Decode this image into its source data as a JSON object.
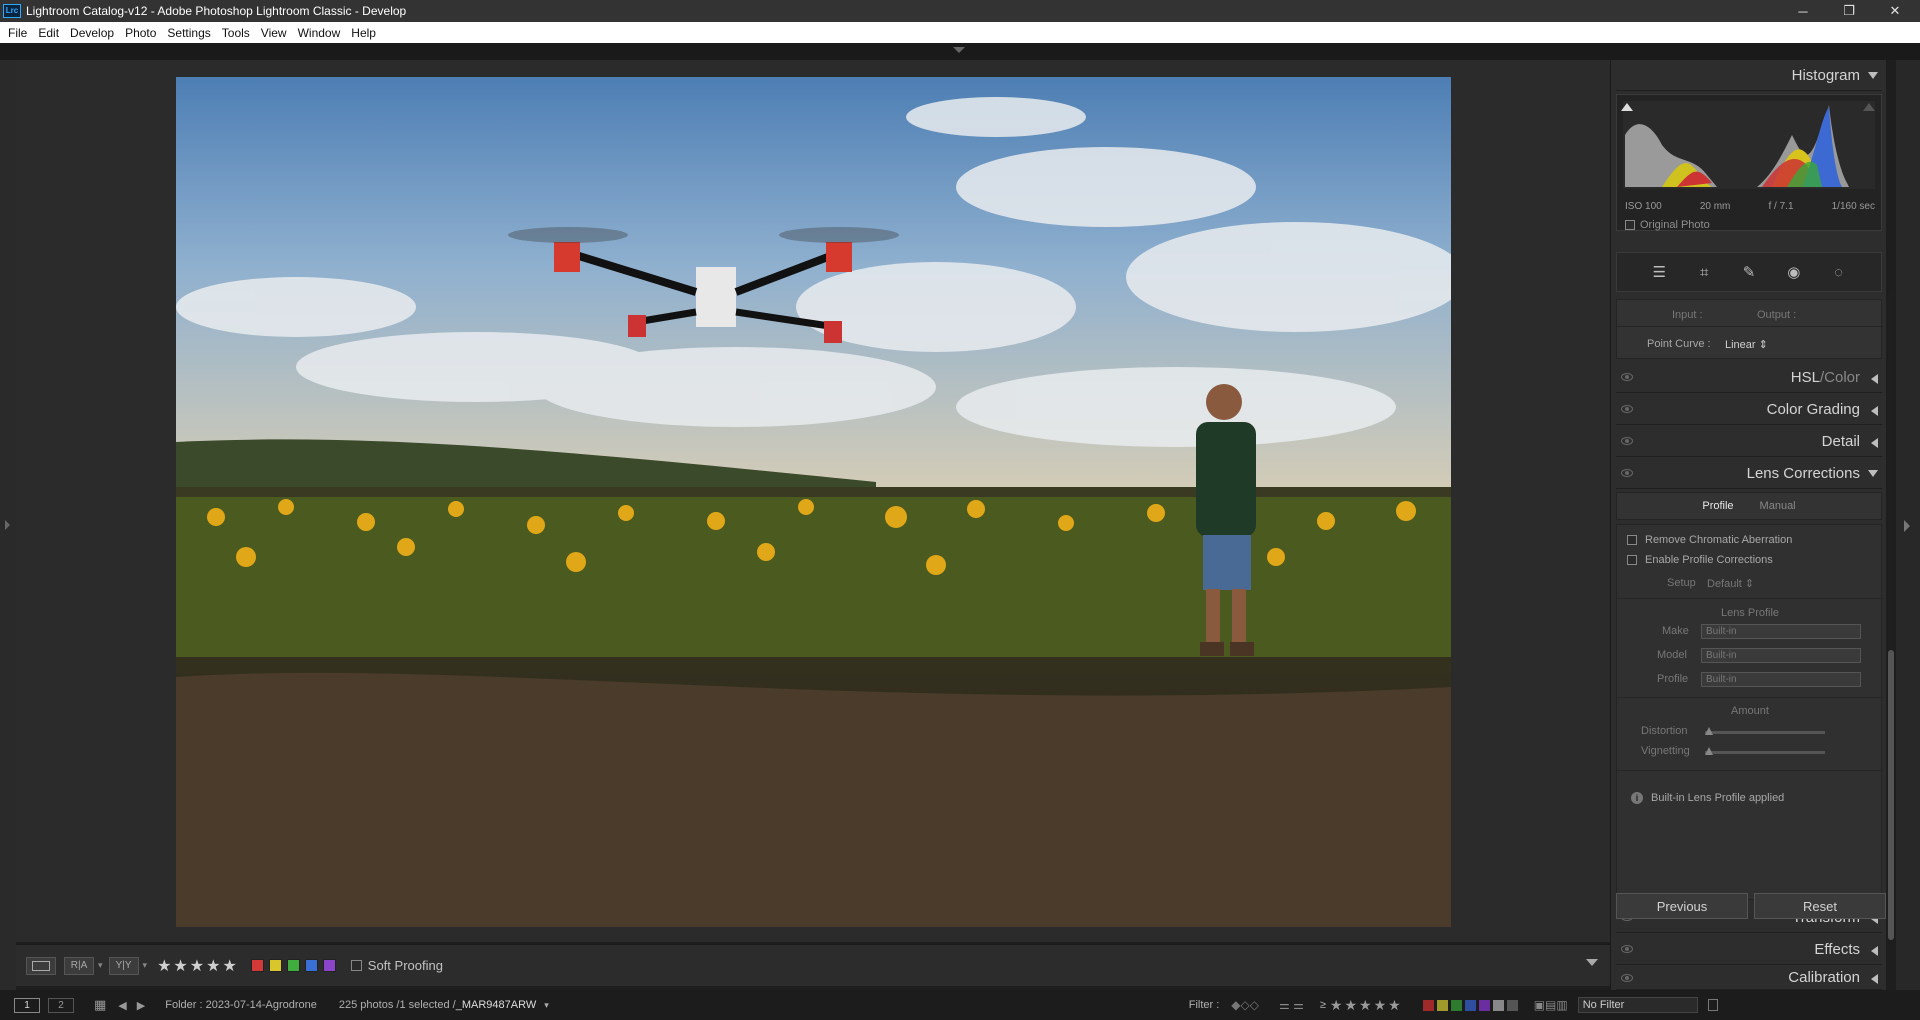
{
  "window": {
    "app_icon": "Lrc",
    "title": "Lightroom Catalog-v12 - Adobe Photoshop Lightroom Classic - Develop",
    "minimize": "─",
    "restore": "❐",
    "close": "✕"
  },
  "menu": [
    {
      "label": "File"
    },
    {
      "label": "Edit"
    },
    {
      "label": "Develop"
    },
    {
      "label": "Photo"
    },
    {
      "label": "Settings"
    },
    {
      "label": "Tools"
    },
    {
      "label": "View"
    },
    {
      "label": "Window"
    },
    {
      "label": "Help"
    }
  ],
  "histogram": {
    "title": "Histogram",
    "iso": "ISO 100",
    "focal": "20 mm",
    "aperture": "f / 7.1",
    "shutter": "1/160 sec",
    "original_photo": "Original Photo"
  },
  "tone_curve": {
    "input": "Input :",
    "output": "Output :",
    "point_curve_label": "Point Curve :",
    "point_curve_value": "Linear ⇕"
  },
  "panels": {
    "hsl": "HSL",
    "hsl_sep": " / ",
    "hsl_color": "Color",
    "color_grading": "Color Grading",
    "detail": "Detail",
    "lens_corrections": "Lens Corrections",
    "transform": "Transform",
    "effects": "Effects",
    "calibration": "Calibration"
  },
  "lens": {
    "tab_profile": "Profile",
    "tab_manual": "Manual",
    "remove_ca": "Remove Chromatic Aberration",
    "enable_profile": "Enable Profile Corrections",
    "setup_label": "Setup",
    "setup_value": "Default ⇕",
    "lens_profile_heading": "Lens Profile",
    "make_label": "Make",
    "make_value": "Built-in",
    "model_label": "Model",
    "model_value": "Built-in",
    "profile_label": "Profile",
    "profile_value": "Built-in",
    "amount_heading": "Amount",
    "distortion_label": "Distortion",
    "vignetting_label": "Vignetting",
    "info": "Built-in Lens Profile applied"
  },
  "buttons": {
    "previous": "Previous",
    "reset": "Reset"
  },
  "toolbar": {
    "view_ra": "R|A",
    "view_yy": "Y|Y",
    "stars": [
      "★",
      "★",
      "★",
      "★",
      "★"
    ],
    "soft_proofing": "Soft Proofing",
    "color_labels": [
      "#d23a3a",
      "#d8c62a",
      "#3fae3f",
      "#3a6fd6",
      "#8a45c8"
    ]
  },
  "filmstrip": {
    "screen1": "1",
    "screen2": "2",
    "folder": "Folder : 2023-07-14-Agrodrone",
    "count": "225 photos /1 selected /",
    "filename": "_MAR9487ARW",
    "filter_label": "Filter :",
    "rating_op": "≥",
    "filter_stars": [
      "★",
      "★",
      "★",
      "★",
      "★"
    ],
    "filter_value": "No Filter"
  }
}
